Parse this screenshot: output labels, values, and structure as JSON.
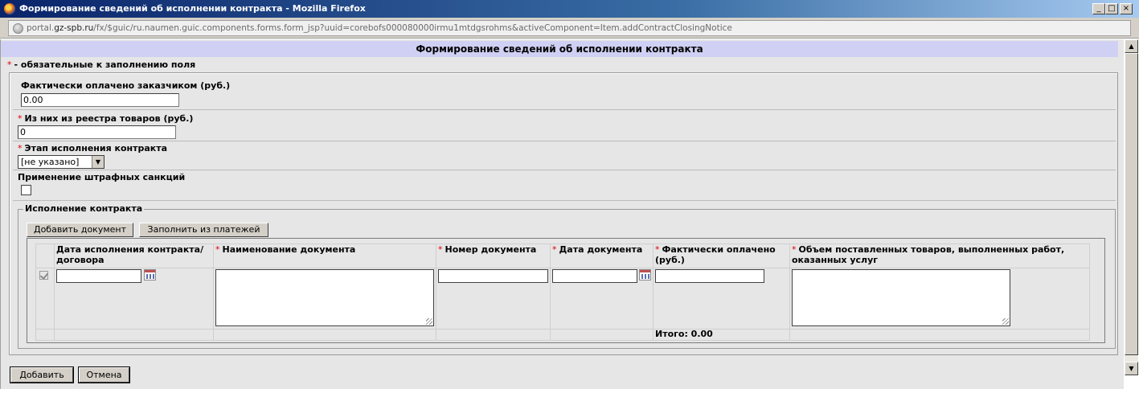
{
  "window": {
    "title": "Формирование сведений об исполнении контракта - Mozilla Firefox",
    "btn_min": "_",
    "btn_max": "□",
    "btn_close": "×"
  },
  "address": {
    "url_prefix": "portal.",
    "url_domain": "gz-spb.ru",
    "url_rest": "/fx/$guic/ru.naumen.guic.components.forms.form_jsp?uuid=corebofs000080000irmu1mtdgsrohms&activeComponent=Item.addContractClosingNotice"
  },
  "form": {
    "header": "Формирование сведений об исполнении контракта",
    "required_note": "- обязательные к заполнению поля",
    "required_star": "*",
    "paid_label": "Фактически оплачено заказчиком (руб.)",
    "paid_value": "0.00",
    "registry_label": "Из них из реестра товаров (руб.)",
    "registry_value": "0",
    "stage_label": "Этап исполнения контракта",
    "stage_value": "[не указано]",
    "penalty_label": "Применение штрафных санкций"
  },
  "execution": {
    "legend": "Исполнение контракта",
    "add_document": "Добавить документ",
    "fill_from_payments": "Заполнить из платежей",
    "columns": [
      "Дата исполнения контракта/договора",
      "Наименование документа",
      "Номер документа",
      "Дата документа",
      "Фактически оплачено (руб.)",
      "Объем поставленных товаров, выполненных работ, оказанных услуг"
    ],
    "total": "Итого: 0.00"
  },
  "footer": {
    "add": "Добавить",
    "cancel": "Отмена"
  },
  "colors": {
    "header_bg": "#cfd0f3",
    "required_star": "#e00000",
    "content_bg": "#e6e6e6"
  }
}
